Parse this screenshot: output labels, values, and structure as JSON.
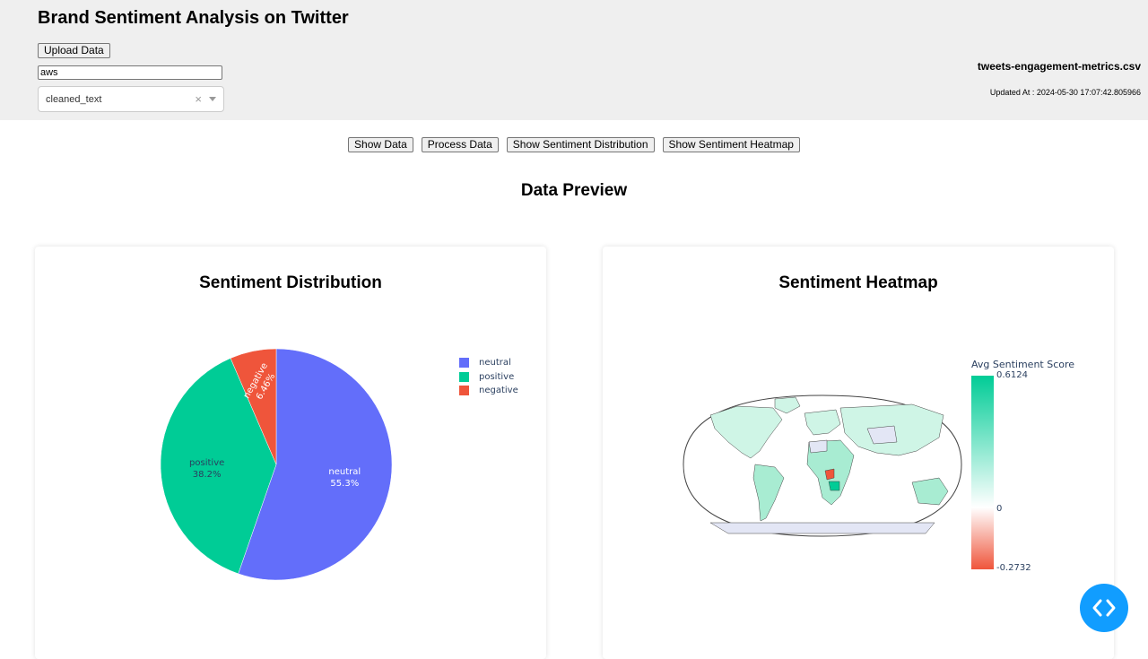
{
  "header": {
    "title": "Brand Sentiment Analysis on Twitter",
    "upload_label": "Upload Data",
    "filter_input_value": "aws",
    "column_select_value": "cleaned_text",
    "clear_glyph": "×",
    "file_name": "tweets-engagement-metrics.csv",
    "updated_at": "Updated At : 2024-05-30 17:07:42.805966"
  },
  "actions": {
    "show_data": "Show Data",
    "process_data": "Process Data",
    "show_distribution": "Show Sentiment Distribution",
    "show_heatmap": "Show Sentiment Heatmap"
  },
  "section_title": "Data Preview",
  "distribution": {
    "title": "Sentiment Distribution",
    "legend": [
      "neutral",
      "positive",
      "negative"
    ]
  },
  "heatmap": {
    "title": "Sentiment Heatmap",
    "colorbar_title": "Avg Sentiment Score",
    "colorbar_max": "0.6124",
    "colorbar_mid": "0",
    "colorbar_min": "-0.2732"
  },
  "colors": {
    "neutral": "#636efa",
    "positive": "#00cc96",
    "negative": "#ef553b",
    "fab": "#119dff"
  },
  "chart_data": [
    {
      "type": "pie",
      "title": "Sentiment Distribution",
      "categories": [
        "neutral",
        "positive",
        "negative"
      ],
      "values": [
        55.3,
        38.2,
        6.46
      ],
      "value_labels": [
        "55.3%",
        "38.2%",
        "6.46%"
      ],
      "legend": "top-right"
    },
    {
      "type": "heatmap",
      "title": "Sentiment Heatmap",
      "colorbar_title": "Avg Sentiment Score",
      "range": [
        -0.2732,
        0.6124
      ]
    }
  ]
}
